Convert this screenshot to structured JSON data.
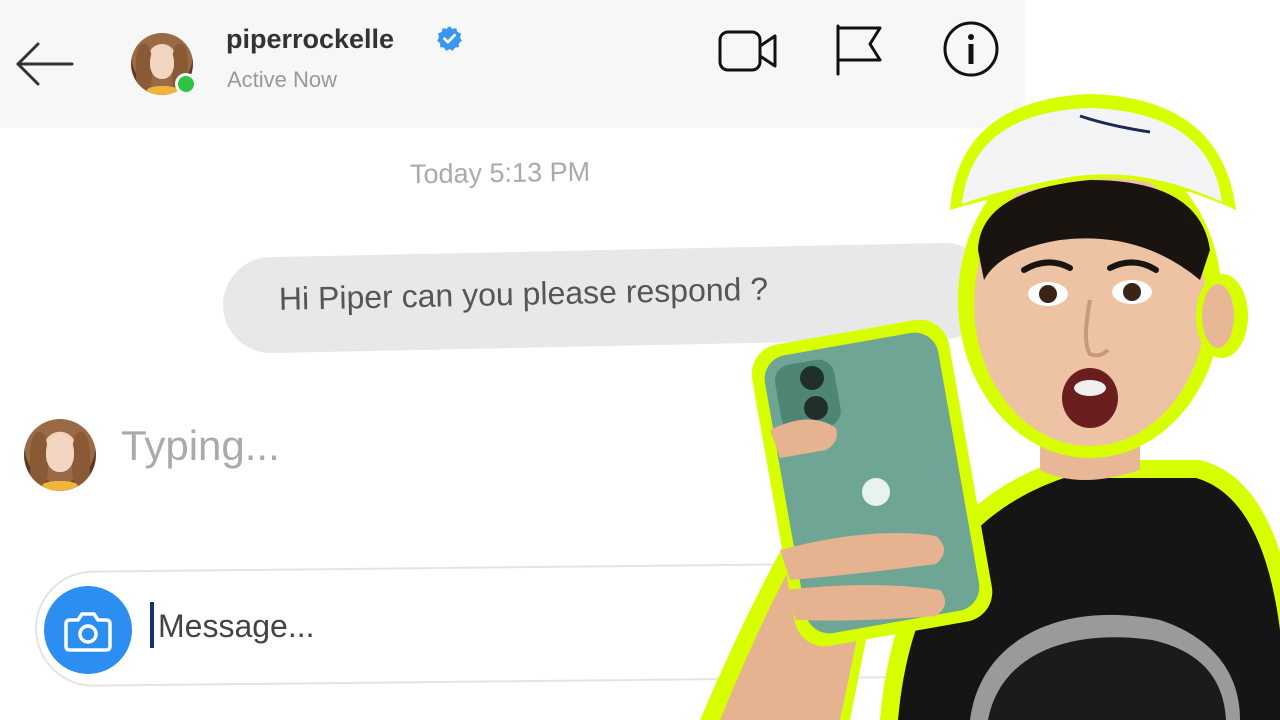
{
  "header": {
    "username": "piperrockelle",
    "status": "Active Now",
    "icons": {
      "back": "arrow-left-icon",
      "verified": "verified-badge-icon",
      "video": "video-camera-icon",
      "flag": "flag-icon",
      "info": "info-icon"
    }
  },
  "chat": {
    "timestamp": "Today 5:13 PM",
    "sent_message": "Hi Piper can you please respond ?",
    "typing_indicator": "Typing..."
  },
  "composer": {
    "placeholder": "Message...",
    "camera_icon": "camera-icon"
  },
  "colors": {
    "accent_blue": "#2c8ef0",
    "online_green": "#2dc443",
    "highlight_outline": "#d8ff00"
  }
}
